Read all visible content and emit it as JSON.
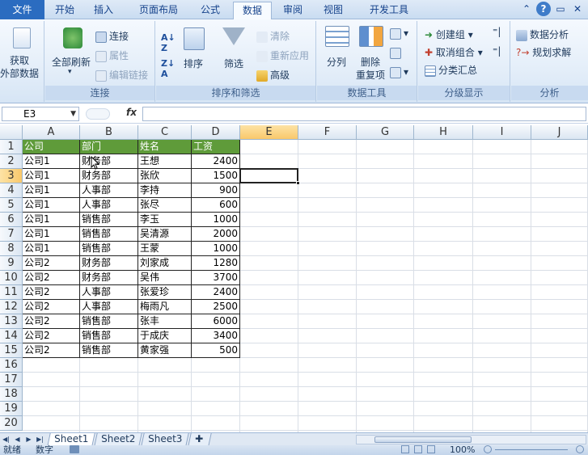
{
  "tabs": {
    "file": "文件",
    "items": [
      "开始",
      "插入",
      "页面布局",
      "公式",
      "数据",
      "审阅",
      "视图",
      "开发工具"
    ],
    "active": "数据"
  },
  "ribbon": {
    "get_external_data": "获取\n外部数据",
    "get_external_line1": "获取",
    "get_external_line2": "外部数据",
    "refresh_all": "全部刷新",
    "connections": "连接",
    "properties": "属性",
    "edit_links": "编辑链接",
    "group_connections": "连接",
    "sort": "排序",
    "filter": "筛选",
    "clear": "清除",
    "reapply": "重新应用",
    "advanced": "高级",
    "group_sort_filter": "排序和筛选",
    "text_to_columns": "分列",
    "remove_duplicates_line1": "删除",
    "remove_duplicates_line2": "重复项",
    "group_data_tools": "数据工具",
    "group": "创建组",
    "ungroup": "取消组合",
    "subtotal": "分类汇总",
    "group_outline": "分级显示",
    "data_analysis": "数据分析",
    "solver": "规划求解",
    "group_analysis": "分析"
  },
  "formula_bar": {
    "name_box": "E3",
    "fx": "fx",
    "formula": ""
  },
  "columns": [
    "A",
    "B",
    "C",
    "D",
    "E",
    "F",
    "G",
    "H",
    "I",
    "J"
  ],
  "rows": [
    "1",
    "2",
    "3",
    "4",
    "5",
    "6",
    "7",
    "8",
    "9",
    "10",
    "11",
    "12",
    "13",
    "14",
    "15",
    "16",
    "17",
    "18",
    "19",
    "20"
  ],
  "table": {
    "headers": [
      "公司",
      "部门",
      "姓名",
      "工资"
    ],
    "rows": [
      [
        "公司1",
        "财务部",
        "王想",
        "2400"
      ],
      [
        "公司1",
        "财务部",
        "张欣",
        "1500"
      ],
      [
        "公司1",
        "人事部",
        "李持",
        "900"
      ],
      [
        "公司1",
        "人事部",
        "张尽",
        "600"
      ],
      [
        "公司1",
        "销售部",
        "李玉",
        "1000"
      ],
      [
        "公司1",
        "销售部",
        "吴清源",
        "2000"
      ],
      [
        "公司1",
        "销售部",
        "王蒙",
        "1000"
      ],
      [
        "公司2",
        "财务部",
        "刘家成",
        "1280"
      ],
      [
        "公司2",
        "财务部",
        "吴伟",
        "3700"
      ],
      [
        "公司2",
        "人事部",
        "张爱珍",
        "2400"
      ],
      [
        "公司2",
        "人事部",
        "梅雨凡",
        "2500"
      ],
      [
        "公司2",
        "销售部",
        "张丰",
        "6000"
      ],
      [
        "公司2",
        "销售部",
        "于成庆",
        "3400"
      ],
      [
        "公司2",
        "销售部",
        "黄家强",
        "500"
      ]
    ]
  },
  "sheets": [
    "Sheet1",
    "Sheet2",
    "Sheet3"
  ],
  "active_sheet": "Sheet1",
  "status": {
    "ready": "就绪",
    "numlock": "数字",
    "zoom": "100%"
  },
  "colors": {
    "header_fill": "#5f9b3a",
    "file_tab": "#2b6cc0",
    "selection_header": "#f9c86b"
  }
}
